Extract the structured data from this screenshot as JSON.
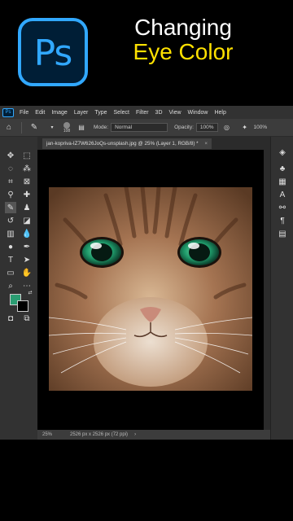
{
  "header": {
    "logo_text": "Ps",
    "title_line1": "Changing",
    "title_line2": "Eye Color"
  },
  "menubar": {
    "app_icon": "Ps",
    "items": [
      "File",
      "Edit",
      "Image",
      "Layer",
      "Type",
      "Select",
      "Filter",
      "3D",
      "View",
      "Window",
      "Help"
    ]
  },
  "options": {
    "brush_size": "108",
    "mode_label": "Mode:",
    "mode_value": "Normal",
    "opacity_label": "Opacity:",
    "opacity_value": "100%",
    "flow_value": "100%"
  },
  "document": {
    "tab_title": "jan-kopriva-IZ7W626JoQs-unsplash.jpg @ 25% (Layer 1, RGB/8) *",
    "close": "×"
  },
  "status": {
    "zoom": "25%",
    "dimensions": "2526 px x 2526 px (72 ppi)",
    "arrow": "›"
  },
  "colors": {
    "foreground": "#2a9d72",
    "background": "#000000",
    "accent": "#31a8ff",
    "title_highlight": "#ffe100"
  }
}
